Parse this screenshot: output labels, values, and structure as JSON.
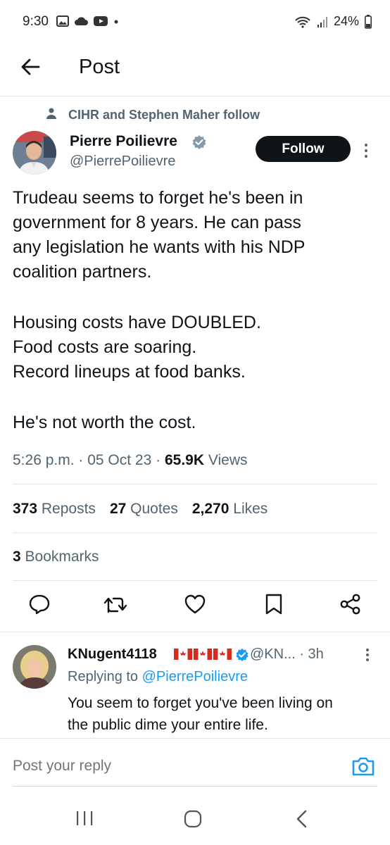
{
  "status_bar": {
    "time": "9:30",
    "battery": "24%"
  },
  "header": {
    "title": "Post"
  },
  "social_context": {
    "text": "CIHR and Stephen Maher follow"
  },
  "post": {
    "author_name": "Pierre Poilievre",
    "author_handle": "@PierrePoilievre",
    "follow_label": "Follow",
    "text_lines": [
      "Trudeau seems to forget he's been in",
      "government for 8 years. He can pass",
      "any legislation he wants with his NDP",
      "coalition partners.",
      "Housing costs have DOUBLED.",
      "Food costs are soaring.",
      "Record lineups at food banks.",
      "He's not worth the cost."
    ],
    "time": "5:26 p.m.",
    "date": "05 Oct 23",
    "views_count": "65.9K",
    "views_label": "Views",
    "reposts_count": "373",
    "reposts_label": "Reposts",
    "quotes_count": "27",
    "quotes_label": "Quotes",
    "likes_count": "2,270",
    "likes_label": "Likes",
    "bookmarks_count": "3",
    "bookmarks_label": "Bookmarks"
  },
  "actions": {
    "icons": [
      "reply-icon",
      "repost-icon",
      "like-icon",
      "bookmark-icon",
      "share-icon"
    ]
  },
  "reply": {
    "author_name": "KNugent4118",
    "author_handle": "@KN...",
    "age": "· 3h",
    "replying_prefix": "Replying to",
    "replying_handle": "@PierrePoilievre",
    "text_lines": [
      "You seem to forget you've been living on",
      "the public dime your entire life."
    ]
  },
  "composer": {
    "placeholder": "Post your reply"
  },
  "colors": {
    "accent": "#1d9bf0",
    "text_primary": "#0f1419",
    "text_secondary": "#536471",
    "divider": "#e7e7e7"
  }
}
